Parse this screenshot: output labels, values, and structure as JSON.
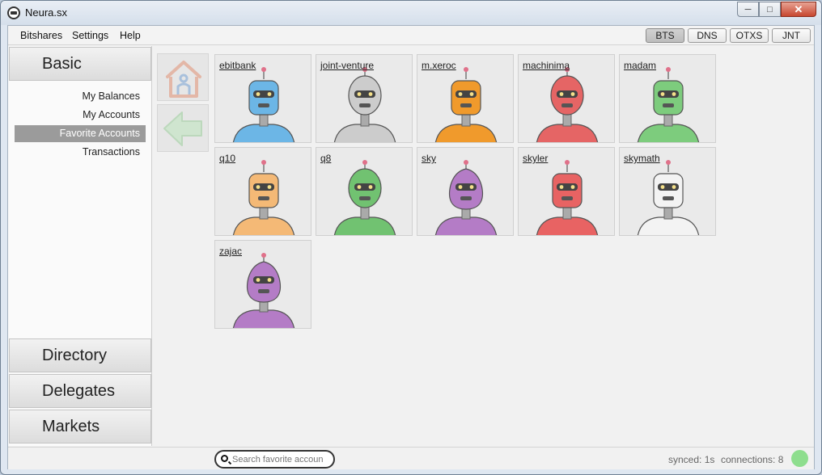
{
  "window": {
    "title": "Neura.sx",
    "minimize": "─",
    "maximize": "□",
    "close": "✕"
  },
  "menu": [
    "Bitshares",
    "Settings",
    "Help"
  ],
  "chains": {
    "items": [
      "BTS",
      "DNS",
      "OTXS",
      "JNT"
    ],
    "active": "BTS"
  },
  "sidebar": {
    "sections": [
      "Basic",
      "Directory",
      "Delegates",
      "Markets"
    ],
    "items": [
      {
        "label": "My Balances",
        "active": false
      },
      {
        "label": "My Accounts",
        "active": false
      },
      {
        "label": "Favorite Accounts",
        "active": true
      },
      {
        "label": "Transactions",
        "active": false
      }
    ]
  },
  "toolbar": {
    "home_icon": "home-icon",
    "back_icon": "back-arrow-icon"
  },
  "accounts": [
    {
      "name": "ebitbank",
      "color": "#6cb6e6",
      "shape": "tall"
    },
    {
      "name": "joint-venture",
      "color": "#cccccc",
      "shape": "oval"
    },
    {
      "name": "m.xeroc",
      "color": "#f09a2c",
      "shape": "tall"
    },
    {
      "name": "machinima",
      "color": "#e56565",
      "shape": "oval"
    },
    {
      "name": "madam",
      "color": "#7dcc7d",
      "shape": "tall"
    },
    {
      "name": "q10",
      "color": "#f4b976",
      "shape": "tall"
    },
    {
      "name": "q8",
      "color": "#71c271",
      "shape": "oval"
    },
    {
      "name": "sky",
      "color": "#b47cc6",
      "shape": "egg"
    },
    {
      "name": "skyler",
      "color": "#e86363",
      "shape": "tall"
    },
    {
      "name": "skymath",
      "color": "#f3f3f3",
      "shape": "tall"
    },
    {
      "name": "zajac",
      "color": "#b47cc6",
      "shape": "egg"
    }
  ],
  "search": {
    "placeholder": "Search favorite accoun"
  },
  "status": {
    "synced": "synced: 1s",
    "connections": "connections: 8",
    "connection_color": "#8ede8e"
  }
}
